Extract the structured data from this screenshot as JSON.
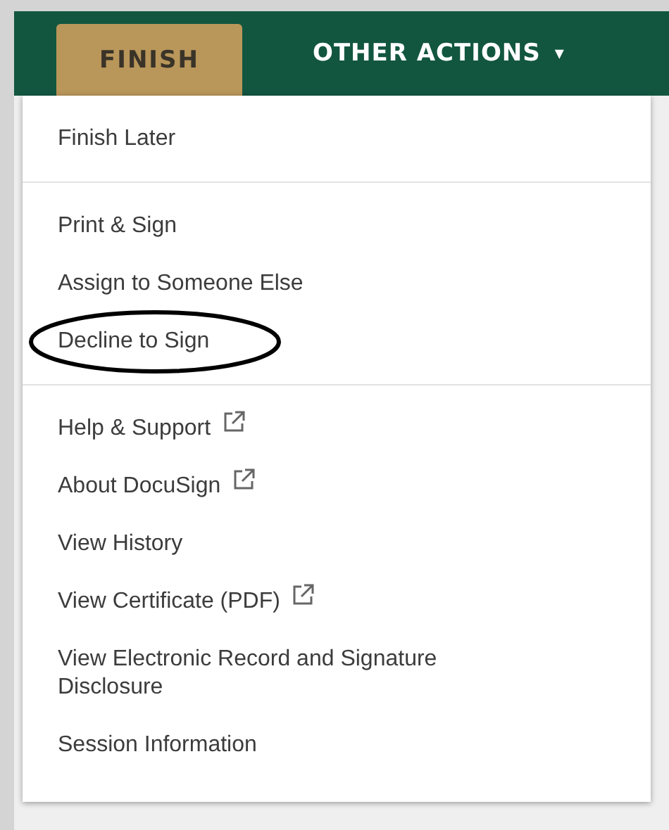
{
  "toolbar": {
    "finish_button": "FINISH",
    "other_actions": {
      "label": "OTHER ACTIONS",
      "caret": "▾"
    }
  },
  "menu": {
    "groups": [
      {
        "items": [
          {
            "label": "Finish Later",
            "external": false,
            "circled": false
          }
        ]
      },
      {
        "items": [
          {
            "label": "Print & Sign",
            "external": false,
            "circled": false
          },
          {
            "label": "Assign to Someone Else",
            "external": false,
            "circled": false
          },
          {
            "label": "Decline to Sign",
            "external": false,
            "circled": true
          }
        ]
      },
      {
        "items": [
          {
            "label": "Help & Support",
            "external": true,
            "circled": false
          },
          {
            "label": "About DocuSign",
            "external": true,
            "circled": false
          },
          {
            "label": "View History",
            "external": false,
            "circled": false
          },
          {
            "label": "View Certificate (PDF)",
            "external": true,
            "circled": false
          },
          {
            "label": "View Electronic Record and Signature Disclosure",
            "external": false,
            "circled": false
          },
          {
            "label": "Session Information",
            "external": false,
            "circled": false
          }
        ]
      }
    ]
  }
}
